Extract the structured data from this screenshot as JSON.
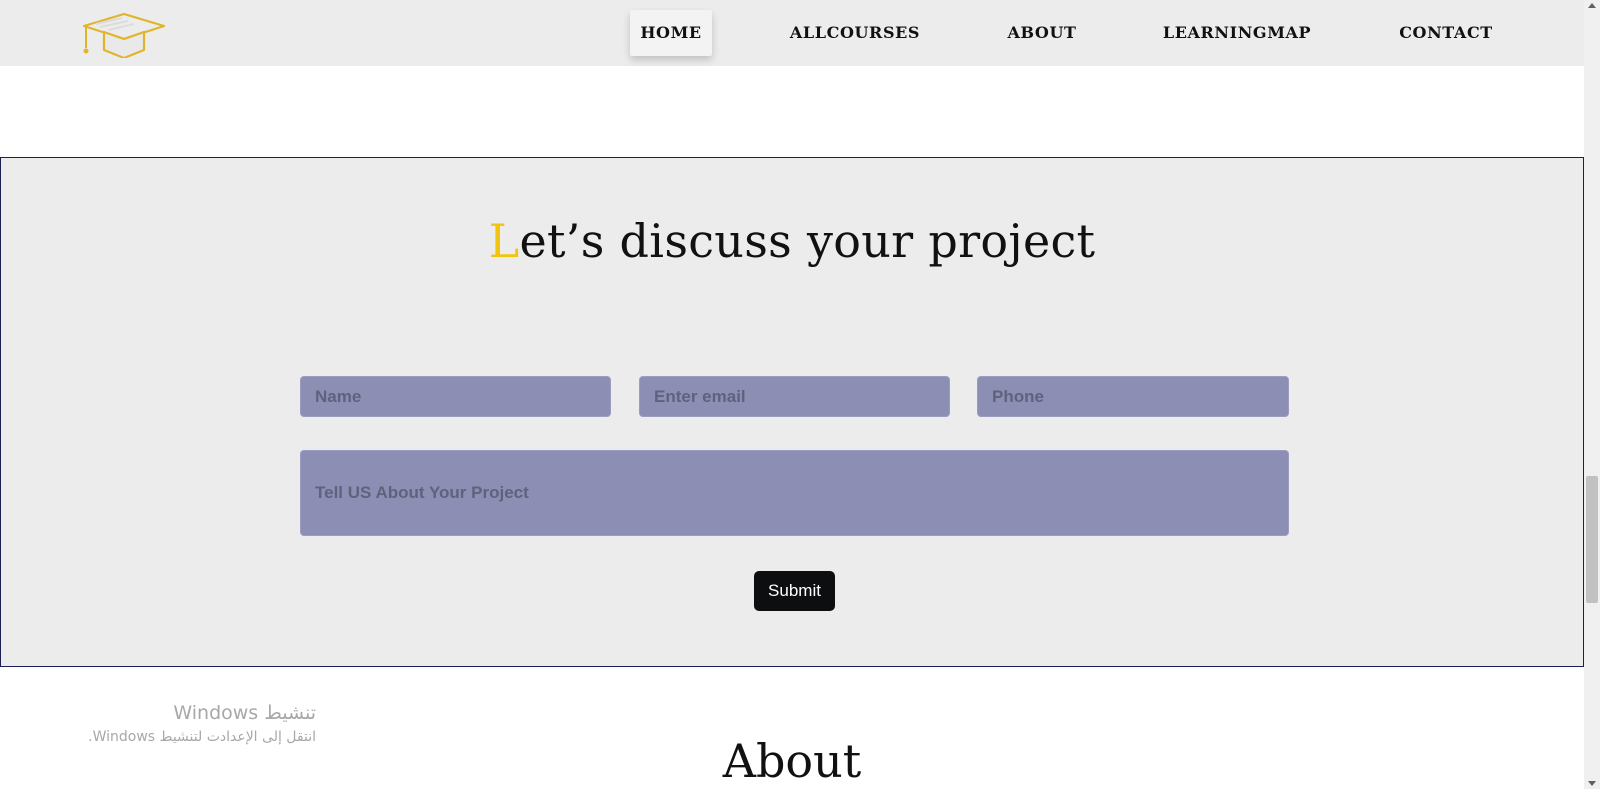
{
  "nav": {
    "items": [
      {
        "label": "HOME",
        "active": true
      },
      {
        "label": "ALLCOURSES",
        "active": false
      },
      {
        "label": "ABOUT",
        "active": false
      },
      {
        "label": "LEARNINGMAP",
        "active": false
      },
      {
        "label": "CONTACT",
        "active": false
      }
    ],
    "logo_icon": "graduation-cap-icon"
  },
  "contact": {
    "heading_first": "L",
    "heading_rest": "et’s discuss your project",
    "name_placeholder": "Name",
    "email_placeholder": "Enter email",
    "phone_placeholder": "Phone",
    "project_placeholder": "Tell US About Your Project",
    "submit_label": "Submit"
  },
  "watermark": {
    "title": "تنشيط Windows",
    "subtitle": "انتقل إلى الإعدادت لتنشيط Windows."
  },
  "about": {
    "heading": "About"
  },
  "colors": {
    "accent": "#f1c40f",
    "field_bg": "#8c8fb3",
    "section_bg": "#ececec",
    "section_border": "#1c1f52",
    "button_bg": "#0d0e10"
  }
}
